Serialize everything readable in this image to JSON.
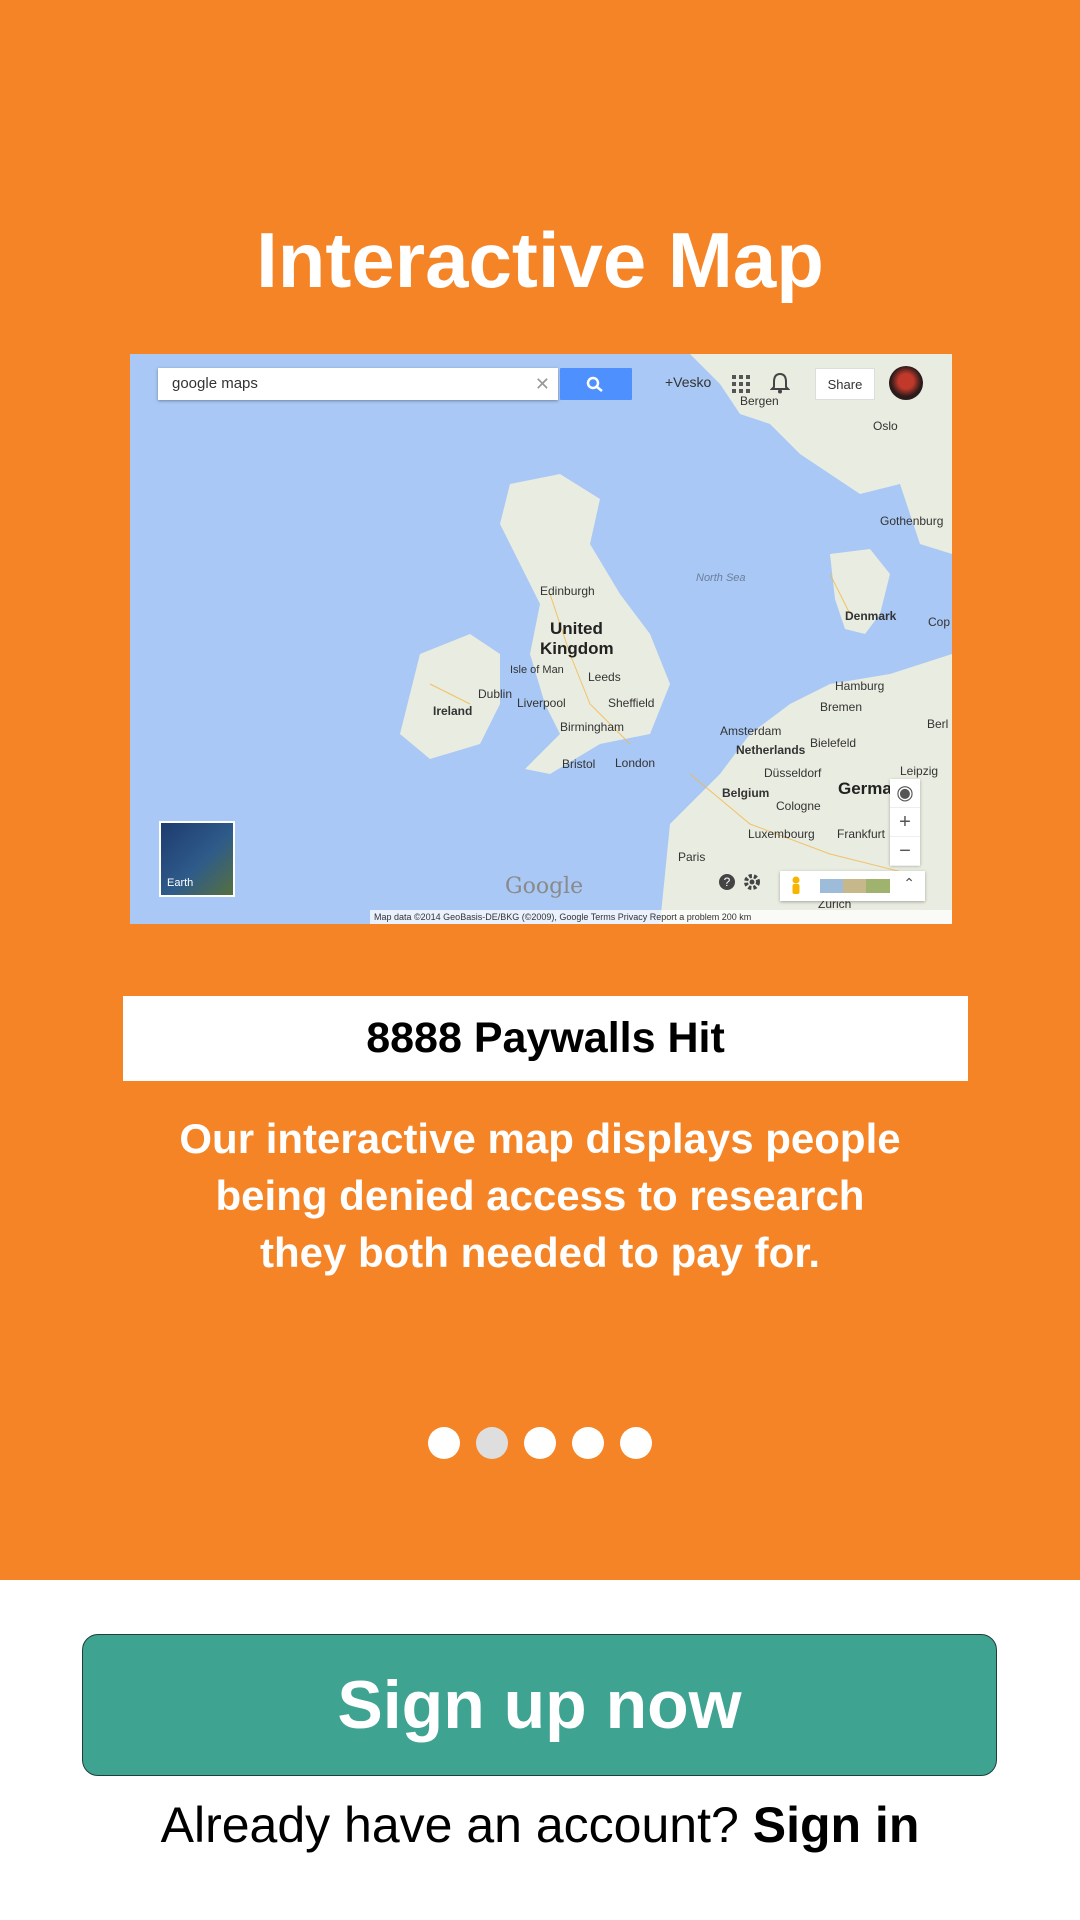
{
  "header": {
    "title": "Interactive Map"
  },
  "map": {
    "search_value": "google maps",
    "user": "+Vesko",
    "share_label": "Share",
    "earth_label": "Earth",
    "google_logo": "Google",
    "attribution": "Map data ©2014 GeoBasis-DE/BKG (©2009), Google    Terms    Privacy    Report a problem    200 km",
    "labels": {
      "bergen": "Bergen",
      "oslo": "Oslo",
      "gothenburg": "Gothenburg",
      "north_sea": "North Sea",
      "denmark": "Denmark",
      "cop": "Cop",
      "edinburgh": "Edinburgh",
      "united": "United",
      "kingdom": "Kingdom",
      "isle_of_man": "Isle of Man",
      "leeds": "Leeds",
      "dublin": "Dublin",
      "liverpool": "Liverpool",
      "sheffield": "Sheffield",
      "ireland": "Ireland",
      "birmingham": "Birmingham",
      "bristol": "Bristol",
      "london": "London",
      "hamburg": "Hamburg",
      "bremen": "Bremen",
      "berl": "Berl",
      "amsterdam": "Amsterdam",
      "bielefeld": "Bielefeld",
      "netherlands": "Netherlands",
      "leipzig": "Leipzig",
      "dusseldorf": "Düsseldorf",
      "belgium": "Belgium",
      "cologne": "Cologne",
      "germa": "Germa",
      "luxembourg": "Luxembourg",
      "frankfurt": "Frankfurt",
      "paris": "Paris",
      "zurich": "Zurich"
    }
  },
  "stats": {
    "paywalls_hit": "8888 Paywalls Hit"
  },
  "description": {
    "line1": "Our interactive map displays people",
    "line2": "being denied access to research",
    "line3": "they both needed to pay for."
  },
  "carousel": {
    "total": 5,
    "active_index": 2
  },
  "cta": {
    "signup_label": "Sign up now",
    "signin_prompt": "Already have an account?",
    "signin_label": "Sign in"
  }
}
